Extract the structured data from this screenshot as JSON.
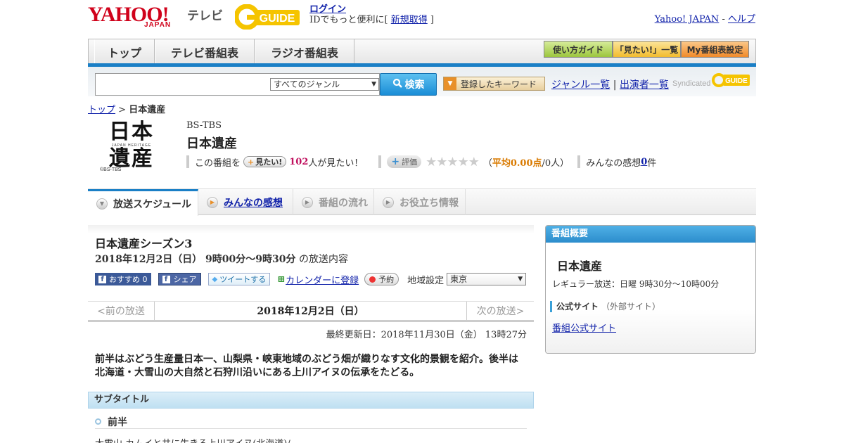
{
  "header": {
    "logo_yahoo": "YAHOO!",
    "logo_japan": "JAPAN",
    "logo_tv": "テレビ",
    "logo_gguide": "GUIDE",
    "login_label": "ログイン",
    "login_hint_prefix": "IDでもっと便利に[ ",
    "signup_label": "新規取得",
    "login_hint_suffix": " ]",
    "yahoo_japan_link": "Yahoo! JAPAN",
    "sep": " - ",
    "help_link": "ヘルプ"
  },
  "nav": {
    "tabs": [
      {
        "label": "トップ"
      },
      {
        "label": "テレビ番組表"
      },
      {
        "label": "ラジオ番組表"
      }
    ],
    "right_buttons": [
      {
        "label": "使い方ガイド"
      },
      {
        "label": "「見たい!」一覧"
      },
      {
        "label": "My番組表設定"
      }
    ]
  },
  "search": {
    "input_value": "",
    "genre_selected": "すべてのジャンル",
    "search_button": "検索",
    "keyword_button": "登録したキーワード",
    "genre_list_link": "ジャンル一覧",
    "link_sep": " | ",
    "performer_list_link": "出演者一覧",
    "syndicated_label": "Syndicated"
  },
  "breadcrumb": {
    "top": "トップ",
    "sep": " > ",
    "current": "日本遺産"
  },
  "program": {
    "logo_text_1": "日本",
    "logo_text_sub": "JAPAN HERITAGE",
    "logo_text_2": "遺産",
    "logo_copyright": "©BS-TBS",
    "channel": "BS-TBS",
    "title": "日本遺産",
    "want_prefix": "この番組を",
    "want_button": "見たい!",
    "want_count": "102",
    "want_suffix": "人が見たい！",
    "rate_button": "評価",
    "stars": "★★★★★",
    "avg_open": "（",
    "avg_label": "平均0.00点",
    "avg_people": "/0人）",
    "impressions_label": "みんなの感想 ",
    "impressions_count": "0",
    "impressions_suffix": "件"
  },
  "tabs": [
    {
      "label": "放送スケジュール",
      "active": true
    },
    {
      "label": "みんなの感想",
      "active": false,
      "link": true
    },
    {
      "label": "番組の流れ",
      "active": false
    },
    {
      "label": "お役立ち情報",
      "active": false
    }
  ],
  "episode": {
    "title": "日本遺産シーズン3",
    "date_time": "2018年12月2日（日） 9時00分～9時30分",
    "date_suffix": " の放送内容",
    "recommend_btn": "おすすめ 0",
    "share_btn": "シェア",
    "tweet_btn": "ツイートする",
    "calendar_link": "カレンダーに登録",
    "reserve_btn": "予約",
    "region_label": "地域設定",
    "region_selected": "東京",
    "prev": "<前の放送",
    "current_date": "2018年12月2日（日）",
    "next": "次の放送>",
    "updated": "最終更新日：2018年11月30日（金） 13時27分",
    "description": "前半はぶどう生産量日本一、山梨県・峡東地域のぶどう畑が織りなす文化的景観を紹介。後半は北海道・大雪山の大自然と石狩川沿いにある上川アイヌの伝承をたどる。",
    "subtitle_heading": "サブタイトル",
    "subtitle_item": "前半",
    "subtitle_next": "大雪山 カムイと共に生きる上川アイヌ(北海道)/"
  },
  "sidebar": {
    "heading": "番組概要",
    "title": "日本遺産",
    "regular": "レギュラー放送：日曜 9時30分～10時00分",
    "official_label": "公式サイト",
    "official_note": "（外部サイト）",
    "official_link": "番組公式サイト"
  },
  "colors": {
    "accent_blue": "#1a7fc6",
    "yahoo_red": "#d0021b",
    "gguide_yellow": "#f5c400",
    "want_count": "#c0105e",
    "avg_orange": "#d97a00"
  }
}
